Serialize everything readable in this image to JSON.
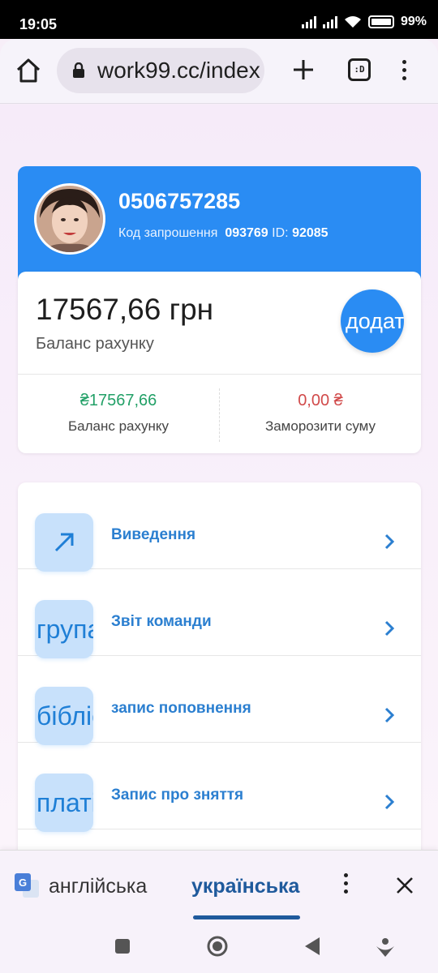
{
  "status_bar": {
    "time": "19:05",
    "battery": "99%"
  },
  "browser": {
    "url": "work99.cc/index",
    "tabs_label": ":D"
  },
  "profile": {
    "phone": "0506757285",
    "invite_label": "Код запрошення",
    "invite_code": "093769",
    "id_label": "ID:",
    "id_value": "92085"
  },
  "balance": {
    "amount": "17567,66 грн",
    "label": "Баланс рахунку",
    "add_button": "додати",
    "stats": [
      {
        "value": "₴17567,66",
        "label": "Баланс рахунку"
      },
      {
        "value": "0,00 ₴",
        "label": "Заморозити суму"
      }
    ]
  },
  "menu": {
    "items": [
      {
        "icon_text": "↗",
        "label": "Виведення"
      },
      {
        "icon_text": "група",
        "label": "Звіт команди"
      },
      {
        "icon_text": "бібліотека",
        "label": "запис поповнення"
      },
      {
        "icon_text": "платіж",
        "label": "Запис про зняття"
      }
    ]
  },
  "translate_bar": {
    "source_lang": "англійська",
    "target_lang": "українська"
  },
  "colors": {
    "accent": "#2a8cf3",
    "positive": "#22a067",
    "negative": "#d14a4a",
    "link": "#2b7fd0"
  }
}
